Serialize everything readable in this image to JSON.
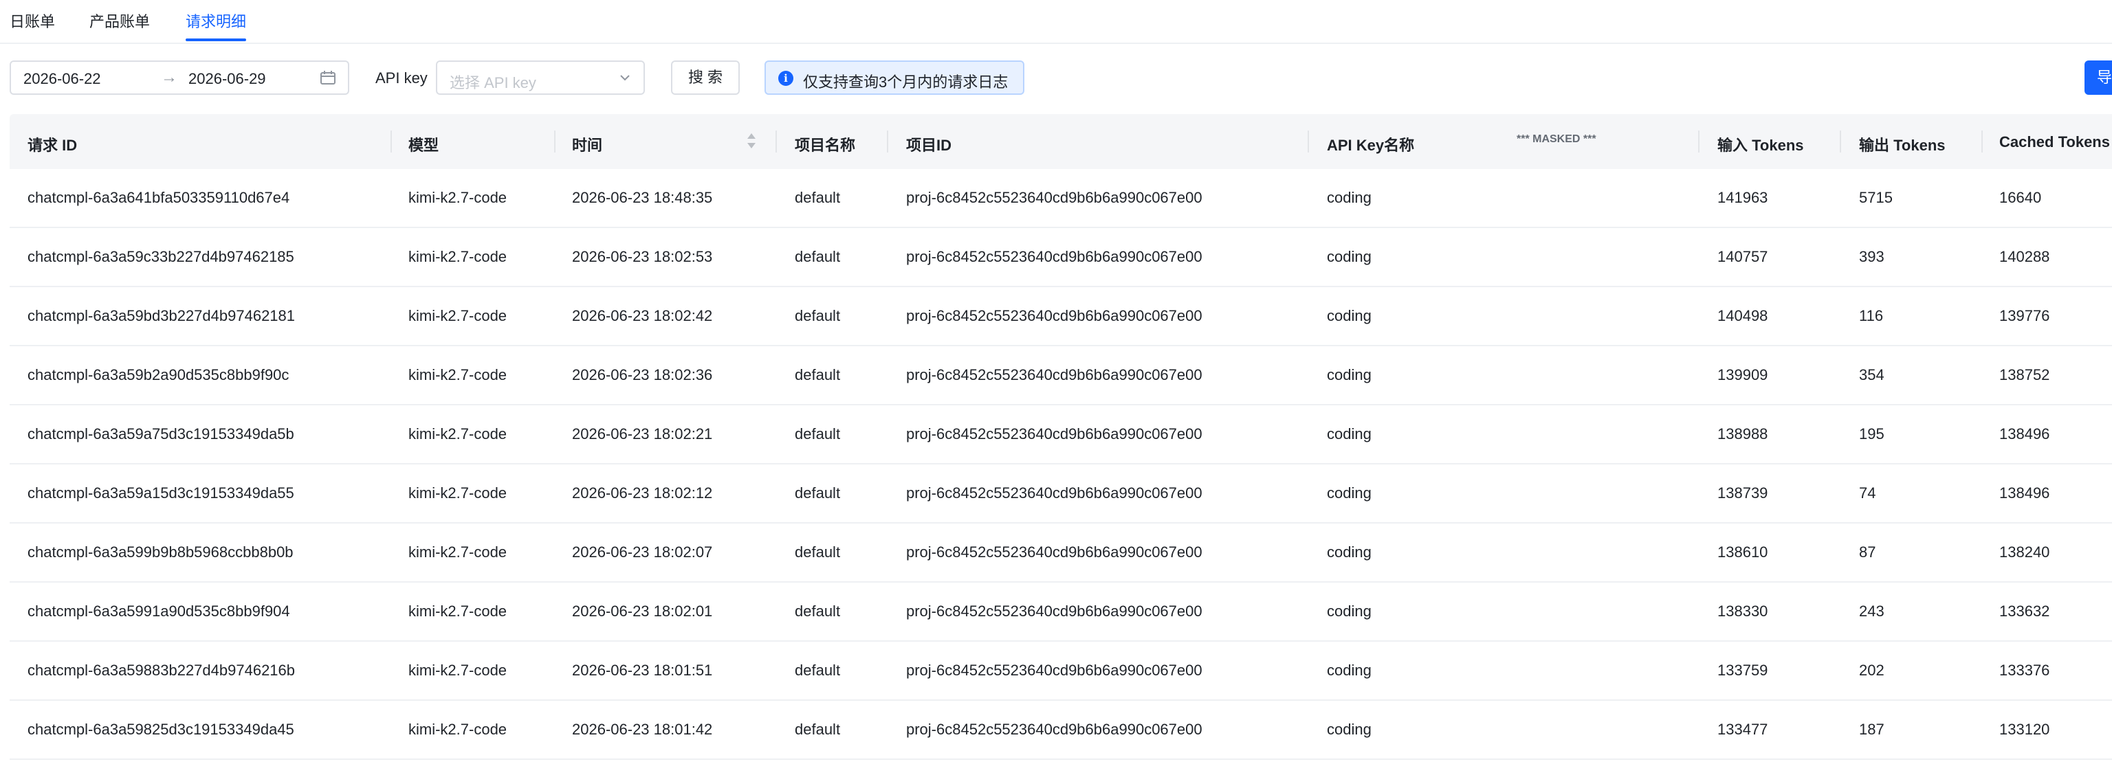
{
  "tabs": [
    {
      "label": "日账单"
    },
    {
      "label": "产品账单"
    },
    {
      "label": "请求明细"
    }
  ],
  "active_tab": 2,
  "filters": {
    "start_date": "2026-06-22",
    "separator": "→",
    "end_date": "2026-06-29",
    "api_key_label": "API key",
    "api_key_placeholder": "选择 API key",
    "search_label": "搜 索",
    "notice": "仅支持查询3个月内的请求日志",
    "export_label": "导"
  },
  "table": {
    "columns": {
      "request_id": "请求 ID",
      "model": "模型",
      "time": "时间",
      "project_name": "项目名称",
      "project_id": "项目ID",
      "api_key_name": "API Key名称",
      "masked": "*** MASKED ***",
      "input_tokens": "输入 Tokens",
      "output_tokens": "输出 Tokens",
      "cached_tokens": "Cached Tokens"
    },
    "rows": [
      {
        "request_id": "chatcmpl-6a3a641bfa503359110d67e4",
        "model": "kimi-k2.7-code",
        "time": "2026-06-23 18:48:35",
        "project_name": "default",
        "project_id": "proj-6c8452c5523640cd9b6b6a990c067e00",
        "api_key_name": "coding",
        "input_tokens": "141963",
        "output_tokens": "5715",
        "cached_tokens": "16640"
      },
      {
        "request_id": "chatcmpl-6a3a59c33b227d4b97462185",
        "model": "kimi-k2.7-code",
        "time": "2026-06-23 18:02:53",
        "project_name": "default",
        "project_id": "proj-6c8452c5523640cd9b6b6a990c067e00",
        "api_key_name": "coding",
        "input_tokens": "140757",
        "output_tokens": "393",
        "cached_tokens": "140288"
      },
      {
        "request_id": "chatcmpl-6a3a59bd3b227d4b97462181",
        "model": "kimi-k2.7-code",
        "time": "2026-06-23 18:02:42",
        "project_name": "default",
        "project_id": "proj-6c8452c5523640cd9b6b6a990c067e00",
        "api_key_name": "coding",
        "input_tokens": "140498",
        "output_tokens": "116",
        "cached_tokens": "139776"
      },
      {
        "request_id": "chatcmpl-6a3a59b2a90d535c8bb9f90c",
        "model": "kimi-k2.7-code",
        "time": "2026-06-23 18:02:36",
        "project_name": "default",
        "project_id": "proj-6c8452c5523640cd9b6b6a990c067e00",
        "api_key_name": "coding",
        "input_tokens": "139909",
        "output_tokens": "354",
        "cached_tokens": "138752"
      },
      {
        "request_id": "chatcmpl-6a3a59a75d3c19153349da5b",
        "model": "kimi-k2.7-code",
        "time": "2026-06-23 18:02:21",
        "project_name": "default",
        "project_id": "proj-6c8452c5523640cd9b6b6a990c067e00",
        "api_key_name": "coding",
        "input_tokens": "138988",
        "output_tokens": "195",
        "cached_tokens": "138496"
      },
      {
        "request_id": "chatcmpl-6a3a59a15d3c19153349da55",
        "model": "kimi-k2.7-code",
        "time": "2026-06-23 18:02:12",
        "project_name": "default",
        "project_id": "proj-6c8452c5523640cd9b6b6a990c067e00",
        "api_key_name": "coding",
        "input_tokens": "138739",
        "output_tokens": "74",
        "cached_tokens": "138496"
      },
      {
        "request_id": "chatcmpl-6a3a599b9b8b5968ccbb8b0b",
        "model": "kimi-k2.7-code",
        "time": "2026-06-23 18:02:07",
        "project_name": "default",
        "project_id": "proj-6c8452c5523640cd9b6b6a990c067e00",
        "api_key_name": "coding",
        "input_tokens": "138610",
        "output_tokens": "87",
        "cached_tokens": "138240"
      },
      {
        "request_id": "chatcmpl-6a3a5991a90d535c8bb9f904",
        "model": "kimi-k2.7-code",
        "time": "2026-06-23 18:02:01",
        "project_name": "default",
        "project_id": "proj-6c8452c5523640cd9b6b6a990c067e00",
        "api_key_name": "coding",
        "input_tokens": "138330",
        "output_tokens": "243",
        "cached_tokens": "133632"
      },
      {
        "request_id": "chatcmpl-6a3a59883b227d4b9746216b",
        "model": "kimi-k2.7-code",
        "time": "2026-06-23 18:01:51",
        "project_name": "default",
        "project_id": "proj-6c8452c5523640cd9b6b6a990c067e00",
        "api_key_name": "coding",
        "input_tokens": "133759",
        "output_tokens": "202",
        "cached_tokens": "133376"
      },
      {
        "request_id": "chatcmpl-6a3a59825d3c19153349da45",
        "model": "kimi-k2.7-code",
        "time": "2026-06-23 18:01:42",
        "project_name": "default",
        "project_id": "proj-6c8452c5523640cd9b6b6a990c067e00",
        "api_key_name": "coding",
        "input_tokens": "133477",
        "output_tokens": "187",
        "cached_tokens": "133120"
      }
    ]
  },
  "colors": {
    "accent": "#1664ff",
    "header_bg": "#f5f6f8",
    "notice_bg": "#e8f1ff",
    "border": "#dcdfe5"
  }
}
